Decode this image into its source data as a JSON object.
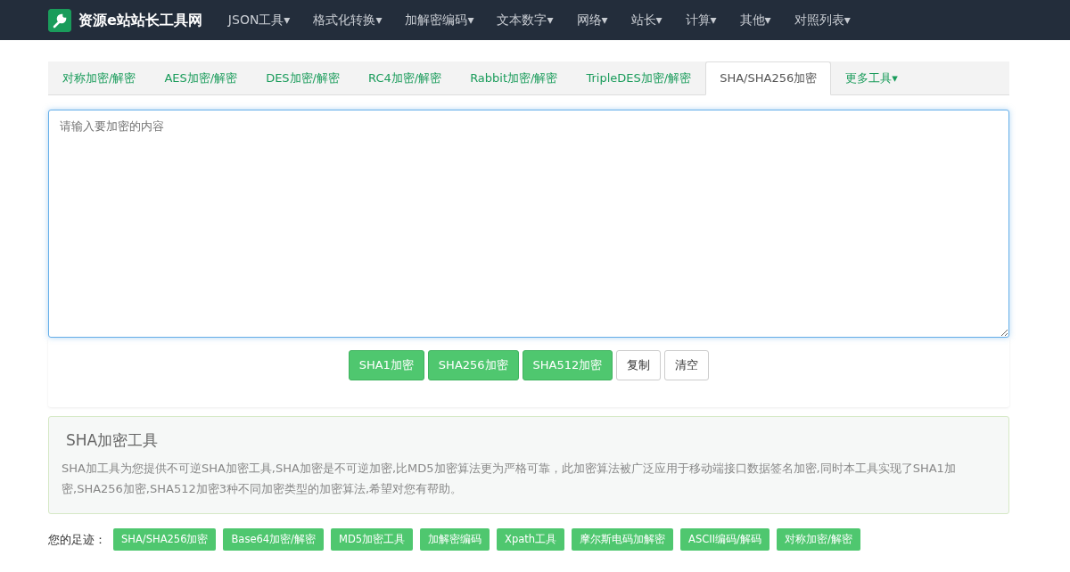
{
  "brand": {
    "title": "资源e站站长工具网"
  },
  "nav": [
    {
      "label": "JSON工具",
      "caret": "▾"
    },
    {
      "label": "格式化转换",
      "caret": "▾"
    },
    {
      "label": "加解密编码",
      "caret": "▾"
    },
    {
      "label": "文本数字",
      "caret": "▾"
    },
    {
      "label": "网络",
      "caret": "▾"
    },
    {
      "label": "站长",
      "caret": "▾"
    },
    {
      "label": "计算",
      "caret": "▾"
    },
    {
      "label": "其他",
      "caret": "▾"
    },
    {
      "label": "对照列表",
      "caret": "▾"
    }
  ],
  "tabs": [
    {
      "label": "对称加密/解密",
      "selected": false
    },
    {
      "label": "AES加密/解密",
      "selected": false
    },
    {
      "label": "DES加密/解密",
      "selected": false
    },
    {
      "label": "RC4加密/解密",
      "selected": false
    },
    {
      "label": "Rabbit加密/解密",
      "selected": false
    },
    {
      "label": "TripleDES加密/解密",
      "selected": false
    },
    {
      "label": "SHA/SHA256加密",
      "selected": true
    },
    {
      "label": "更多工具",
      "selected": false,
      "caret": "▾"
    }
  ],
  "input": {
    "placeholder": "请输入要加密的内容"
  },
  "buttons": [
    {
      "label": "SHA1加密",
      "kind": "primary"
    },
    {
      "label": "SHA256加密",
      "kind": "primary"
    },
    {
      "label": "SHA512加密",
      "kind": "primary"
    },
    {
      "label": "复制",
      "kind": "plain"
    },
    {
      "label": "清空",
      "kind": "plain"
    }
  ],
  "info": {
    "title": "SHA加密工具",
    "text": "SHA加工具为您提供不可逆SHA加密工具,SHA加密是不可逆加密,比MD5加密算法更为严格可靠，此加密算法被广泛应用于移动端接口数据签名加密,同时本工具实现了SHA1加密,SHA256加密,SHA512加密3种不同加密类型的加密算法,希望对您有帮助。"
  },
  "footprints": {
    "label": "您的足迹：",
    "items": [
      "SHA/SHA256加密",
      "Base64加密/解密",
      "MD5加密工具",
      "加解密编码",
      "Xpath工具",
      "摩尔斯电码加解密",
      "ASCII编码/解码",
      "对称加密/解密"
    ]
  }
}
